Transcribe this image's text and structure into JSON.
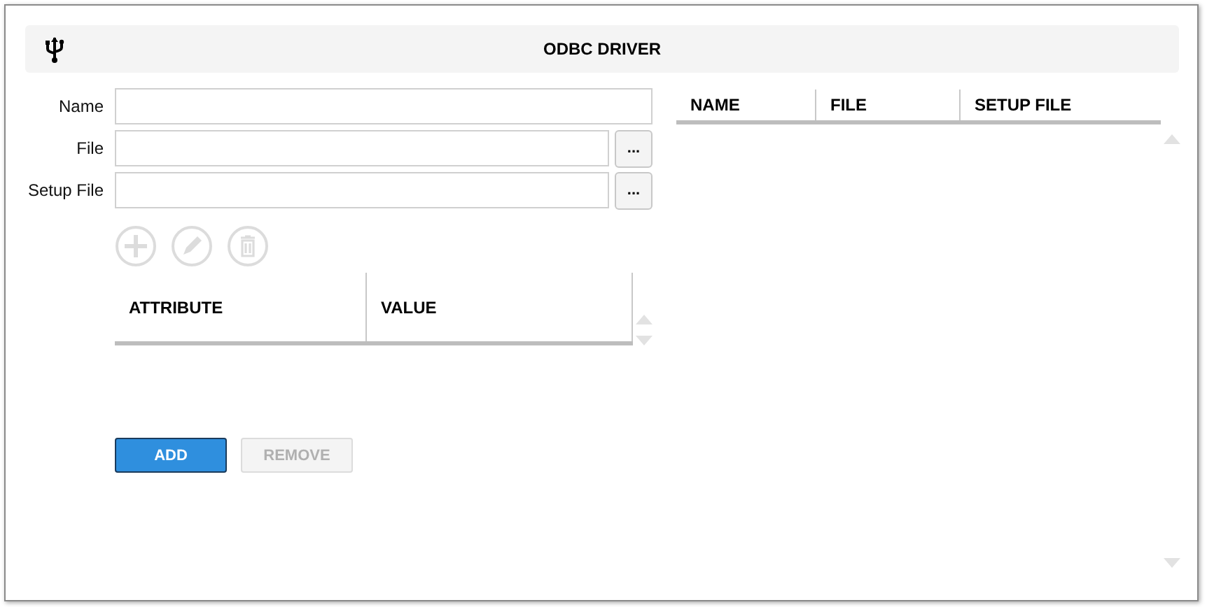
{
  "header": {
    "title": "ODBC DRIVER"
  },
  "form": {
    "fields": [
      {
        "label": "Name",
        "kind": "text"
      },
      {
        "label": "File",
        "kind": "browse",
        "browse_label": "..."
      },
      {
        "label": "Setup File",
        "kind": "browse",
        "browse_label": "..."
      }
    ]
  },
  "attribute_toolbar": [
    {
      "kind": "add",
      "disabled": true
    },
    {
      "kind": "edit",
      "disabled": true
    },
    {
      "kind": "delete",
      "disabled": true
    }
  ],
  "attribute_table": {
    "columns": [
      "ATTRIBUTE",
      "VALUE"
    ]
  },
  "buttons": [
    {
      "label": "ADD",
      "disabled": false
    },
    {
      "label": "REMOVE",
      "disabled": true
    }
  ],
  "driver_table": {
    "columns": [
      "NAME",
      "FILE",
      "SETUP FILE"
    ]
  }
}
